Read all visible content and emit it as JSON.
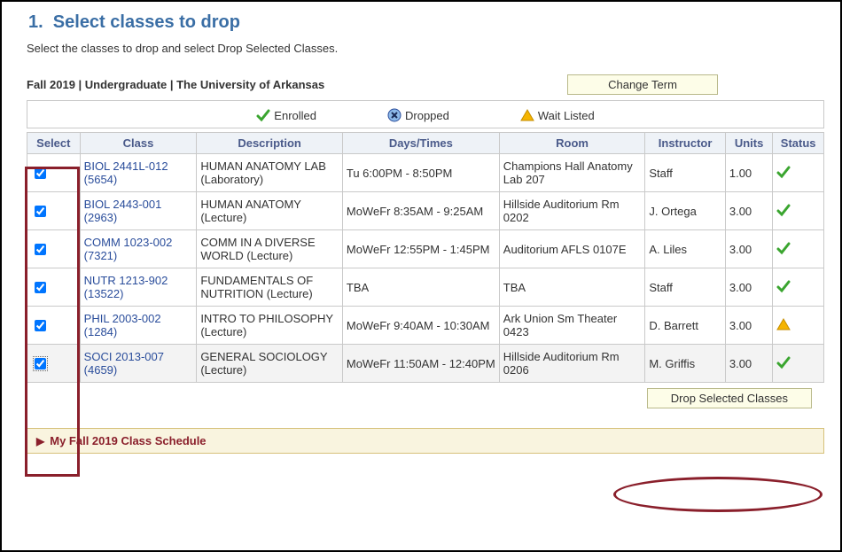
{
  "heading": "1.  Select classes to drop",
  "subtext": "Select the classes to drop and select Drop Selected Classes.",
  "term_label": "Fall 2019 | Undergraduate | The University of Arkansas",
  "buttons": {
    "change_term": "Change Term",
    "drop_selected": "Drop Selected Classes"
  },
  "legend": {
    "enrolled": "Enrolled",
    "dropped": "Dropped",
    "waitlisted": "Wait Listed"
  },
  "columns": {
    "select": "Select",
    "class": "Class",
    "description": "Description",
    "days": "Days/Times",
    "room": "Room",
    "instructor": "Instructor",
    "units": "Units",
    "status": "Status"
  },
  "rows": [
    {
      "checked": true,
      "class_link": "BIOL 2441L-012 (5654)",
      "desc": "HUMAN ANATOMY LAB (Laboratory)",
      "days": "Tu 6:00PM - 8:50PM",
      "room": "Champions Hall Anatomy Lab 207",
      "instructor": "Staff",
      "units": "1.00",
      "status": "enrolled"
    },
    {
      "checked": true,
      "class_link": "BIOL 2443-001 (2963)",
      "desc": "HUMAN ANATOMY (Lecture)",
      "days": "MoWeFr 8:35AM - 9:25AM",
      "room": "Hillside Auditorium Rm 0202",
      "instructor": "J. Ortega",
      "units": "3.00",
      "status": "enrolled"
    },
    {
      "checked": true,
      "class_link": "COMM 1023-002 (7321)",
      "desc": "COMM IN A DIVERSE WORLD (Lecture)",
      "days": "MoWeFr 12:55PM - 1:45PM",
      "room": "Auditorium AFLS 0107E",
      "instructor": "A. Liles",
      "units": "3.00",
      "status": "enrolled"
    },
    {
      "checked": true,
      "class_link": "NUTR 1213-902 (13522)",
      "desc": "FUNDAMENTALS OF NUTRITION (Lecture)",
      "days": "TBA",
      "room": "TBA",
      "instructor": "Staff",
      "units": "3.00",
      "status": "enrolled"
    },
    {
      "checked": true,
      "class_link": "PHIL 2003-002 (1284)",
      "desc": "INTRO TO PHILOSOPHY (Lecture)",
      "days": "MoWeFr 9:40AM - 10:30AM",
      "room": "Ark Union Sm Theater 0423",
      "instructor": "D. Barrett",
      "units": "3.00",
      "status": "waitlisted"
    },
    {
      "checked": true,
      "class_link": "SOCI 2013-007 (4659)",
      "desc": "GENERAL SOCIOLOGY (Lecture)",
      "days": "MoWeFr 11:50AM - 12:40PM",
      "room": "Hillside Auditorium Rm 0206",
      "instructor": "M. Griffis",
      "units": "3.00",
      "status": "enrolled",
      "hover": true,
      "focus": true
    }
  ],
  "panel_title": "My Fall 2019 Class Schedule"
}
